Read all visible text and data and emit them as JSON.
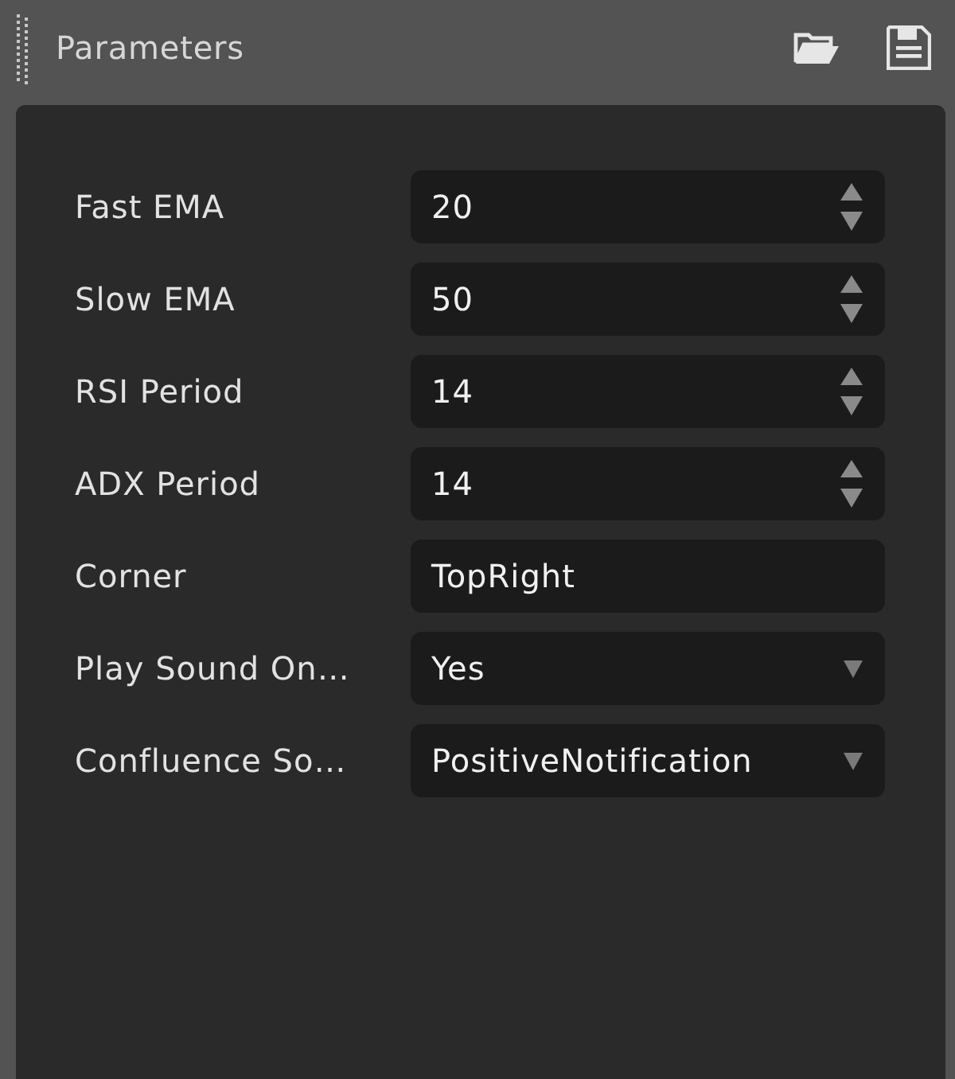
{
  "panel": {
    "title": "Parameters"
  },
  "fields": [
    {
      "label": "Fast EMA",
      "kind": "number",
      "value": "20"
    },
    {
      "label": "Slow EMA",
      "kind": "number",
      "value": "50"
    },
    {
      "label": "RSI Period",
      "kind": "number",
      "value": "14"
    },
    {
      "label": "ADX Period",
      "kind": "number",
      "value": "14"
    },
    {
      "label": "Corner",
      "kind": "text",
      "value": "TopRight"
    },
    {
      "label": "Play Sound On…",
      "kind": "dropdown",
      "value": "Yes"
    },
    {
      "label": "Confluence So…",
      "kind": "dropdown",
      "value": "PositiveNotification"
    }
  ]
}
